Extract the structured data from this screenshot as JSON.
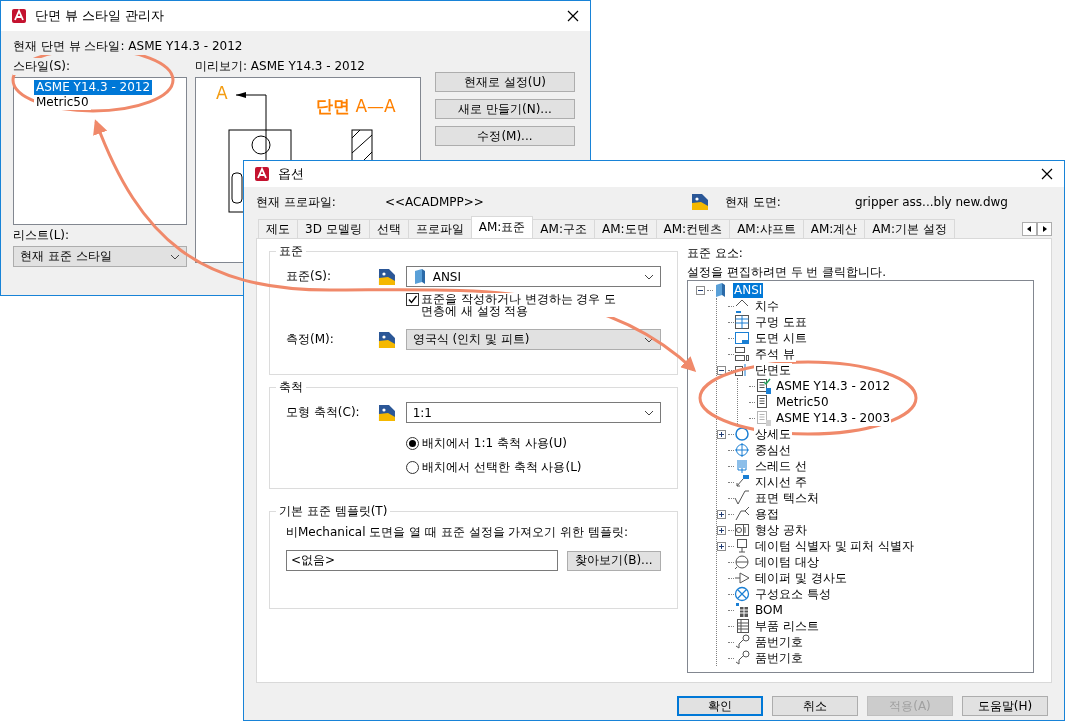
{
  "style_manager": {
    "title": "단면 뷰 스타일 관리자",
    "current_style": "현재 단면 뷰 스타일: ASME Y14.3 - 2012",
    "styles_label": "스타일(S):",
    "styles": [
      {
        "label": "ASME Y14.3 - 2012",
        "selected": true
      },
      {
        "label": "Metric50",
        "selected": false
      }
    ],
    "preview_label": "미리보기: ASME Y14.3 - 2012",
    "preview": {
      "marker": "A",
      "title": "**단면** A—A"
    },
    "buttons": [
      {
        "label": "현재로 설정(U)"
      },
      {
        "label": "새로 만들기(N)..."
      },
      {
        "label": "수정(M)..."
      }
    ],
    "list_label": "리스트(L):",
    "list_value": "현재 표준 스타일"
  },
  "options": {
    "title": "옵션",
    "profile_label": "현재 프로파일:",
    "profile": "<<ACADMPP>>",
    "drawing_label": "현재 도면:",
    "drawing": "gripper ass...bly new.dwg",
    "tabs": [
      {
        "label": "제도",
        "selected": false
      },
      {
        "label": "3D 모델링",
        "selected": false
      },
      {
        "label": "선택",
        "selected": false
      },
      {
        "label": "프로파일",
        "selected": false
      },
      {
        "label": "AM:표준",
        "selected": true
      },
      {
        "label": "AM:구조",
        "selected": false
      },
      {
        "label": "AM:도면",
        "selected": false
      },
      {
        "label": "AM:컨텐츠",
        "selected": false
      },
      {
        "label": "AM:샤프트",
        "selected": false
      },
      {
        "label": "AM:계산",
        "selected": false
      },
      {
        "label": "AM:기본 설정",
        "selected": false
      }
    ],
    "standard": {
      "title": "표준",
      "standard_label": "표준(S):",
      "standard": "ANSI",
      "apply_label": "표준을 작성하거나 변경하는 경우 도면층에 새 설정 적용",
      "apply_checked": true,
      "measure_label": "측정(M):",
      "measure": "영국식 (인치 및 피트)"
    },
    "scale": {
      "title": "축척",
      "model_scale_label": "모형 축척(C):",
      "model_scale": "1:1",
      "options": [
        {
          "label": "배치에서 1:1 축척 사용(U)",
          "selected": true
        },
        {
          "label": "배치에서 선택한 축척 사용(L)",
          "selected": false
        }
      ]
    },
    "template": {
      "title": "기본 표준 템플릿(T)",
      "description": "비Mechanical 도면을 열 때 표준 설정을 가져오기 위한 템플릿:",
      "value": "<없음>",
      "browse": "찾아보기(B)..."
    },
    "elements": {
      "label": "표준 요소:",
      "hint": "설정을 편집하려면 두 번 클릭합니다.",
      "tree": [
        {
          "label": "ANSI",
          "selected": true,
          "expanded": true,
          "children": [
            {
              "label": "치수",
              "selected": false
            },
            {
              "label": "구멍 도표",
              "selected": false
            },
            {
              "label": "도면 시트",
              "selected": false
            },
            {
              "label": "주석 뷰",
              "selected": false
            },
            {
              "label": "단면도",
              "selected": false,
              "expanded": true,
              "children": [
                {
                  "label": "ASME Y14.3 - 2012",
                  "selected": false,
                  "current": true,
                  "dimmed": false
                },
                {
                  "label": "Metric50",
                  "selected": false,
                  "current": false,
                  "dimmed": false
                },
                {
                  "label": "ASME Y14.3 - 2003",
                  "selected": false,
                  "current": false,
                  "dimmed": true
                }
              ]
            },
            {
              "label": "상세도",
              "selected": false,
              "expanded": false
            },
            {
              "label": "중심선",
              "selected": false
            },
            {
              "label": "스레드 선",
              "selected": false
            },
            {
              "label": "지시선 주",
              "selected": false
            },
            {
              "label": "표면 텍스처",
              "selected": false
            },
            {
              "label": "용접",
              "selected": false,
              "expanded": false
            },
            {
              "label": "형상 공차",
              "selected": false,
              "expanded": false
            },
            {
              "label": "데이텀 식별자 및 피처 식별자",
              "selected": false,
              "expanded": false
            },
            {
              "label": "데이텀 대상",
              "selected": false
            },
            {
              "label": "테이퍼 및 경사도",
              "selected": false
            },
            {
              "label": "구성요소 특성",
              "selected": false
            },
            {
              "label": "BOM",
              "selected": false
            },
            {
              "label": "부품 리스트",
              "selected": false
            },
            {
              "label": "품번기호",
              "selected": false
            },
            {
              "label": "품번기호",
              "selected": false
            }
          ]
        }
      ]
    },
    "buttons": [
      {
        "label": "확인",
        "default": true,
        "disabled": false
      },
      {
        "label": "취소",
        "default": false,
        "disabled": false
      },
      {
        "label": "적용(A)",
        "default": false,
        "disabled": true
      },
      {
        "label": "도움말(H)",
        "default": false,
        "disabled": false
      }
    ]
  }
}
